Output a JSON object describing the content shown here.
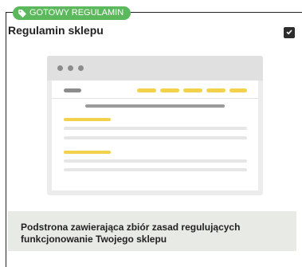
{
  "badge": {
    "label": "GOTOWY REGULAMIN",
    "icon": "tag-icon",
    "color": "#5cb85c"
  },
  "card": {
    "title": "Regulamin sklepu",
    "checkbox": {
      "checked": true,
      "icon": "checkmark-icon"
    }
  },
  "preview": {
    "accent_color": "#f2d24a",
    "window_dots_icon": "window-dots-icon"
  },
  "description": {
    "text": "Podstrona zawierająca zbiór zasad regulujących funkcjonowanie Twojego sklepu"
  }
}
